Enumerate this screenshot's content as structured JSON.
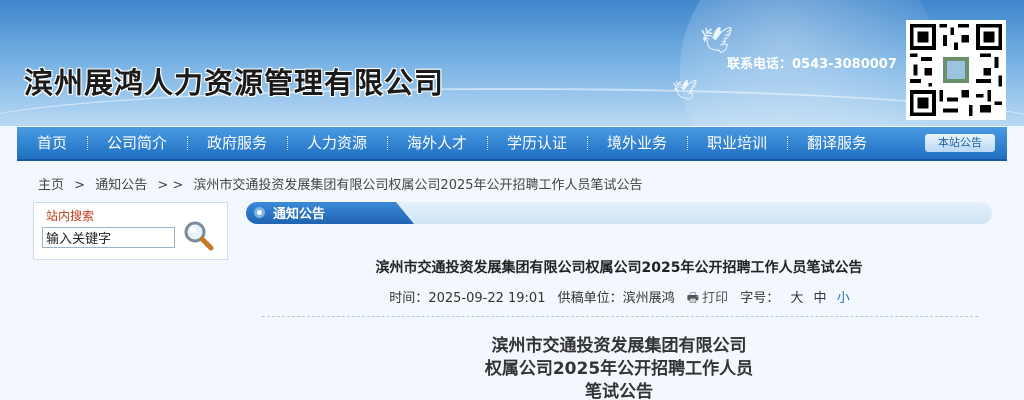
{
  "header": {
    "site_title": "滨州展鸿人力资源管理有限公司",
    "contact": "联系电话：0543-3080007"
  },
  "nav": {
    "items": [
      {
        "label": "首页"
      },
      {
        "label": "公司简介"
      },
      {
        "label": "政府服务"
      },
      {
        "label": "人力资源"
      },
      {
        "label": "海外人才"
      },
      {
        "label": "学历认证"
      },
      {
        "label": "境外业务"
      },
      {
        "label": "职业培训"
      },
      {
        "label": "翻译服务"
      }
    ],
    "badge": "本站公告"
  },
  "breadcrumb": {
    "home": "主页",
    "sep1": ">",
    "section": "通知公告",
    "sep2": "> >",
    "current": "滨州市交通投资发展集团有限公司权属公司2025年公开招聘工作人员笔试公告"
  },
  "search": {
    "title": "站内搜索",
    "value": "输入关键字"
  },
  "panel": {
    "title": "通知公告"
  },
  "article": {
    "title": "滨州市交通投资发展集团有限公司权属公司2025年公开招聘工作人员笔试公告",
    "meta": {
      "time_label": "时间：",
      "time": "2025-09-22 19:01",
      "source_label": "供稿单位：",
      "source": "滨州展鸿",
      "print": "打印",
      "size_label": "字号：",
      "size_large": "大",
      "size_medium": "中",
      "size_small": "小"
    },
    "body_heading": [
      "滨州市交通投资发展集团有限公司",
      "权属公司2025年公开招聘工作人员",
      "笔试公告"
    ]
  },
  "colors": {
    "nav_bg": "#1f6fc2",
    "accent": "#1f6fc2",
    "search_title": "#c03a1a"
  }
}
